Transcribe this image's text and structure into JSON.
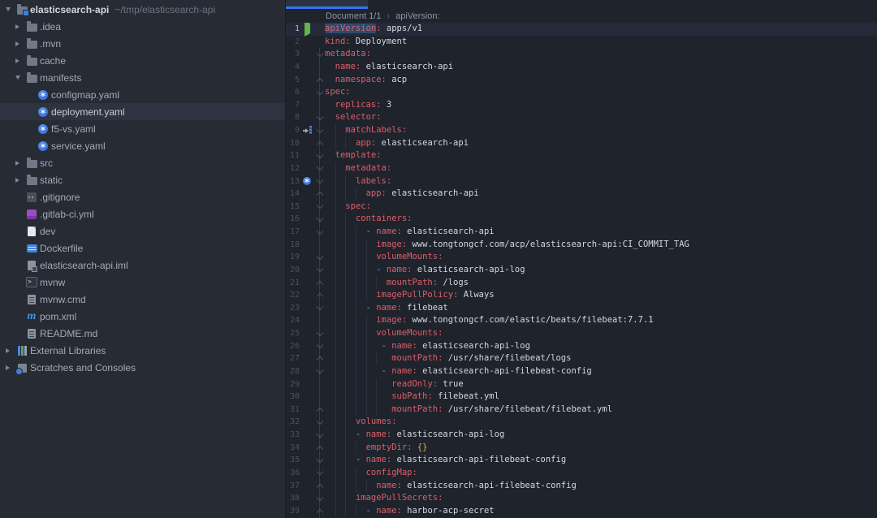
{
  "colors": {
    "accent_blue": "#3574f0",
    "sidebar_bg": "#262b34",
    "editor_bg": "#1f232c",
    "selected_row_bg": "#2d333f",
    "caret_line_bg": "#242a37",
    "word_highlight_bg": "#2d4b70",
    "key_red": "#dc5f6a",
    "value_fg": "#d4d8e0",
    "dash_blue": "#61a8e8",
    "brace_yellow": "#d8b45f",
    "run_green": "#5fb747",
    "k8s_blue": "#3a7ae0"
  },
  "sidebar": {
    "items": [
      {
        "level": 0,
        "arrow": "down",
        "icon": "folder-project",
        "label": "elasticsearch-api",
        "path": "~/tmp/elasticsearch-api",
        "bold": true
      },
      {
        "level": 1,
        "arrow": "right",
        "icon": "folder",
        "label": ".idea"
      },
      {
        "level": 1,
        "arrow": "right",
        "icon": "folder",
        "label": ".mvn"
      },
      {
        "level": 1,
        "arrow": "right",
        "icon": "folder",
        "label": "cache"
      },
      {
        "level": 1,
        "arrow": "down",
        "icon": "folder",
        "label": "manifests"
      },
      {
        "level": 2,
        "icon": "k8s",
        "label": "configmap.yaml"
      },
      {
        "level": 2,
        "icon": "k8s",
        "label": "deployment.yaml",
        "selected": true
      },
      {
        "level": 2,
        "icon": "k8s",
        "label": "f5-vs.yaml"
      },
      {
        "level": 2,
        "icon": "k8s",
        "label": "service.yaml"
      },
      {
        "level": 1,
        "arrow": "right",
        "icon": "folder",
        "label": "src"
      },
      {
        "level": 1,
        "arrow": "right",
        "icon": "folder",
        "label": "static"
      },
      {
        "level": 1,
        "icon": "gitfile",
        "label": ".gitignore"
      },
      {
        "level": 1,
        "icon": "gitlab",
        "label": ".gitlab-ci.yml"
      },
      {
        "level": 1,
        "icon": "file",
        "label": "dev"
      },
      {
        "level": 1,
        "icon": "docker",
        "label": "Dockerfile"
      },
      {
        "level": 1,
        "icon": "iml",
        "label": "elasticsearch-api.iml"
      },
      {
        "level": 1,
        "icon": "shell",
        "label": "mvnw"
      },
      {
        "level": 1,
        "icon": "textfile",
        "label": "mvnw.cmd"
      },
      {
        "level": 1,
        "icon": "maven",
        "label": "pom.xml"
      },
      {
        "level": 1,
        "icon": "textfile",
        "label": "README.md"
      },
      {
        "level": 0,
        "arrow": "right",
        "icon": "extlib",
        "label": "External Libraries"
      },
      {
        "level": 0,
        "arrow": "right",
        "icon": "scratch",
        "label": "Scratches and Consoles"
      }
    ]
  },
  "editor": {
    "breadcrumbs": [
      "Document 1/1",
      "apiVersion:"
    ],
    "breadcrumb_separator": "›",
    "folds": {
      "starts": [
        3,
        6,
        8,
        9,
        11,
        12,
        13,
        15,
        16,
        17,
        19,
        20,
        23,
        25,
        26,
        28,
        32,
        33,
        35,
        36,
        38
      ],
      "ends": [
        5,
        10,
        14,
        21,
        22,
        27,
        31,
        34,
        37,
        39
      ]
    },
    "lines": [
      {
        "n": 1,
        "indent": 0,
        "icon": "run",
        "caret": true,
        "parts": [
          {
            "c": "key-hl",
            "t": "apiVersion"
          },
          {
            "c": "key",
            "t": ":"
          },
          {
            "c": "val",
            "t": " apps/v1"
          }
        ]
      },
      {
        "n": 2,
        "indent": 0,
        "parts": [
          {
            "c": "key",
            "t": "kind:"
          },
          {
            "c": "val",
            "t": " Deployment"
          }
        ]
      },
      {
        "n": 3,
        "indent": 0,
        "parts": [
          {
            "c": "key",
            "t": "metadata:"
          }
        ]
      },
      {
        "n": 4,
        "indent": 2,
        "parts": [
          {
            "c": "key",
            "t": "name:"
          },
          {
            "c": "val",
            "t": " elasticsearch-api"
          }
        ]
      },
      {
        "n": 5,
        "indent": 2,
        "parts": [
          {
            "c": "key",
            "t": "namespace:"
          },
          {
            "c": "val",
            "t": " acp"
          }
        ]
      },
      {
        "n": 6,
        "indent": 0,
        "parts": [
          {
            "c": "key",
            "t": "spec:"
          }
        ]
      },
      {
        "n": 7,
        "indent": 2,
        "parts": [
          {
            "c": "key",
            "t": "replicas:"
          },
          {
            "c": "val",
            "t": " 3"
          }
        ]
      },
      {
        "n": 8,
        "indent": 2,
        "parts": [
          {
            "c": "key",
            "t": "selector:"
          }
        ]
      },
      {
        "n": 9,
        "indent": 4,
        "icon": "jump",
        "parts": [
          {
            "c": "key",
            "t": "matchLabels:"
          }
        ]
      },
      {
        "n": 10,
        "indent": 6,
        "parts": [
          {
            "c": "key",
            "t": "app:"
          },
          {
            "c": "val",
            "t": " elasticsearch-api"
          }
        ]
      },
      {
        "n": 11,
        "indent": 2,
        "parts": [
          {
            "c": "key",
            "t": "template:"
          }
        ]
      },
      {
        "n": 12,
        "indent": 4,
        "parts": [
          {
            "c": "key",
            "t": "metadata:"
          }
        ]
      },
      {
        "n": 13,
        "indent": 6,
        "icon": "k8s",
        "parts": [
          {
            "c": "key",
            "t": "labels:"
          }
        ]
      },
      {
        "n": 14,
        "indent": 8,
        "parts": [
          {
            "c": "key",
            "t": "app:"
          },
          {
            "c": "val",
            "t": " elasticsearch-api"
          }
        ]
      },
      {
        "n": 15,
        "indent": 4,
        "parts": [
          {
            "c": "key",
            "t": "spec:"
          }
        ]
      },
      {
        "n": 16,
        "indent": 6,
        "parts": [
          {
            "c": "key",
            "t": "containers:"
          }
        ]
      },
      {
        "n": 17,
        "indent": 8,
        "parts": [
          {
            "c": "dash",
            "t": "- "
          },
          {
            "c": "key",
            "t": "name:"
          },
          {
            "c": "val",
            "t": " elasticsearch-api"
          }
        ]
      },
      {
        "n": 18,
        "indent": 10,
        "parts": [
          {
            "c": "key",
            "t": "image:"
          },
          {
            "c": "val",
            "t": " www.tongtongcf.com/acp/elasticsearch-api:CI_COMMIT_TAG"
          }
        ]
      },
      {
        "n": 19,
        "indent": 10,
        "parts": [
          {
            "c": "key",
            "t": "volumeMounts:"
          }
        ]
      },
      {
        "n": 20,
        "indent": 10,
        "parts": [
          {
            "c": "dash",
            "t": "- "
          },
          {
            "c": "key",
            "t": "name:"
          },
          {
            "c": "val",
            "t": " elasticsearch-api-log"
          }
        ]
      },
      {
        "n": 21,
        "indent": 12,
        "parts": [
          {
            "c": "key",
            "t": "mountPath:"
          },
          {
            "c": "val",
            "t": " /logs"
          }
        ]
      },
      {
        "n": 22,
        "indent": 10,
        "parts": [
          {
            "c": "key",
            "t": "imagePullPolicy:"
          },
          {
            "c": "val",
            "t": " Always"
          }
        ]
      },
      {
        "n": 23,
        "indent": 8,
        "parts": [
          {
            "c": "dash",
            "t": "- "
          },
          {
            "c": "key",
            "t": "name:"
          },
          {
            "c": "val",
            "t": " filebeat"
          }
        ]
      },
      {
        "n": 24,
        "indent": 10,
        "parts": [
          {
            "c": "key",
            "t": "image:"
          },
          {
            "c": "val",
            "t": " www.tongtongcf.com/elastic/beats/filebeat:7.7.1"
          }
        ]
      },
      {
        "n": 25,
        "indent": 10,
        "parts": [
          {
            "c": "key",
            "t": "volumeMounts:"
          }
        ]
      },
      {
        "n": 26,
        "indent": 11,
        "parts": [
          {
            "c": "dash",
            "t": "- "
          },
          {
            "c": "key",
            "t": "name:"
          },
          {
            "c": "val",
            "t": " elasticsearch-api-log"
          }
        ]
      },
      {
        "n": 27,
        "indent": 13,
        "parts": [
          {
            "c": "key",
            "t": "mountPath:"
          },
          {
            "c": "val",
            "t": " /usr/share/filebeat/logs"
          }
        ]
      },
      {
        "n": 28,
        "indent": 11,
        "parts": [
          {
            "c": "dash",
            "t": "- "
          },
          {
            "c": "key",
            "t": "name:"
          },
          {
            "c": "val",
            "t": " elasticsearch-api-filebeat-config"
          }
        ]
      },
      {
        "n": 29,
        "indent": 13,
        "parts": [
          {
            "c": "key",
            "t": "readOnly:"
          },
          {
            "c": "val",
            "t": " true"
          }
        ]
      },
      {
        "n": 30,
        "indent": 13,
        "parts": [
          {
            "c": "key",
            "t": "subPath:"
          },
          {
            "c": "val",
            "t": " filebeat.yml"
          }
        ]
      },
      {
        "n": 31,
        "indent": 13,
        "parts": [
          {
            "c": "key",
            "t": "mountPath:"
          },
          {
            "c": "val",
            "t": " /usr/share/filebeat/filebeat.yml"
          }
        ]
      },
      {
        "n": 32,
        "indent": 6,
        "parts": [
          {
            "c": "key",
            "t": "volumes:"
          }
        ]
      },
      {
        "n": 33,
        "indent": 6,
        "parts": [
          {
            "c": "dash",
            "t": "- "
          },
          {
            "c": "key",
            "t": "name:"
          },
          {
            "c": "val",
            "t": " elasticsearch-api-log"
          }
        ]
      },
      {
        "n": 34,
        "indent": 8,
        "parts": [
          {
            "c": "key",
            "t": "emptyDir:"
          },
          {
            "c": "val",
            "t": " "
          },
          {
            "c": "brace",
            "t": "{}"
          }
        ]
      },
      {
        "n": 35,
        "indent": 6,
        "parts": [
          {
            "c": "dash",
            "t": "- "
          },
          {
            "c": "key",
            "t": "name:"
          },
          {
            "c": "val",
            "t": " elasticsearch-api-filebeat-config"
          }
        ]
      },
      {
        "n": 36,
        "indent": 8,
        "parts": [
          {
            "c": "key",
            "t": "configMap:"
          }
        ]
      },
      {
        "n": 37,
        "indent": 10,
        "parts": [
          {
            "c": "key",
            "t": "name:"
          },
          {
            "c": "val",
            "t": " elasticsearch-api-filebeat-config"
          }
        ]
      },
      {
        "n": 38,
        "indent": 6,
        "parts": [
          {
            "c": "key",
            "t": "imagePullSecrets:"
          }
        ]
      },
      {
        "n": 39,
        "indent": 8,
        "parts": [
          {
            "c": "dash",
            "t": "- "
          },
          {
            "c": "key",
            "t": "name:"
          },
          {
            "c": "val",
            "t": " harbor-acp-secret"
          }
        ]
      }
    ]
  }
}
